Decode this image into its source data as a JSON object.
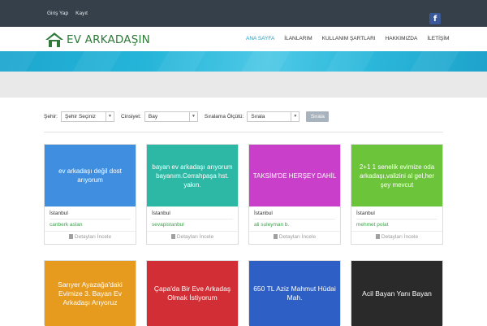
{
  "topbar": {
    "login": "Giriş Yap",
    "register": "Kayıt",
    "facebook": "f"
  },
  "logo": {
    "text": "EV ARKADAŞIN"
  },
  "nav": [
    "ANA SAYFA",
    "İLANLARIM",
    "KULLANIM ŞARTLARI",
    "HAKKIMIZDA",
    "İLETİŞİM"
  ],
  "filters": {
    "city_label": "Şehir:",
    "city_value": "Şehir Seçiniz",
    "gender_label": "Cinsiyet:",
    "gender_value": "Bay",
    "sort_label": "Sıralama Ölçütü:",
    "sort_value": "Sırala",
    "button": "Sırala"
  },
  "listings": [
    {
      "title": "ev arkadaşı değil dost arıyorum",
      "city": "İstanbul",
      "user": "canberk aslan",
      "details": "Detayları İncele",
      "color": "#3f8ee0"
    },
    {
      "title": "bayan ev arkadaşı arıyorum bayanım.Cerrahpaşa hst. yakın.",
      "city": "İstanbul",
      "user": "sevapistanbul",
      "details": "Detayları İncele",
      "color": "#2cb8a4"
    },
    {
      "title": "TAKSİM'DE HERŞEY DAHİL",
      "city": "İstanbul",
      "user": "ali suleyman b.",
      "details": "Detayları İncele",
      "color": "#c93fc9"
    },
    {
      "title": "2+1 1 senelik evimize oda arkadaşı,valizini al gel,her şey mevcut",
      "city": "İstanbul",
      "user": "mehmet polat",
      "details": "Detayları İncele",
      "color": "#6cc43a"
    },
    {
      "title": "Sarıyer Ayazağa'daki Evimize 3. Bayan Ev Arkadaşı Arıyoruz",
      "color": "#e69a1e"
    },
    {
      "title": "Çapa'da Bir Eve Arkadaş Olmak İstiyorum",
      "color": "#d12f35"
    },
    {
      "title": "650 TL Aziz Mahmut Hüdai Mah.",
      "color": "#2d5fc4"
    },
    {
      "title": "Acil Bayan Yanı Bayan",
      "color": "#2a2a2a"
    }
  ]
}
